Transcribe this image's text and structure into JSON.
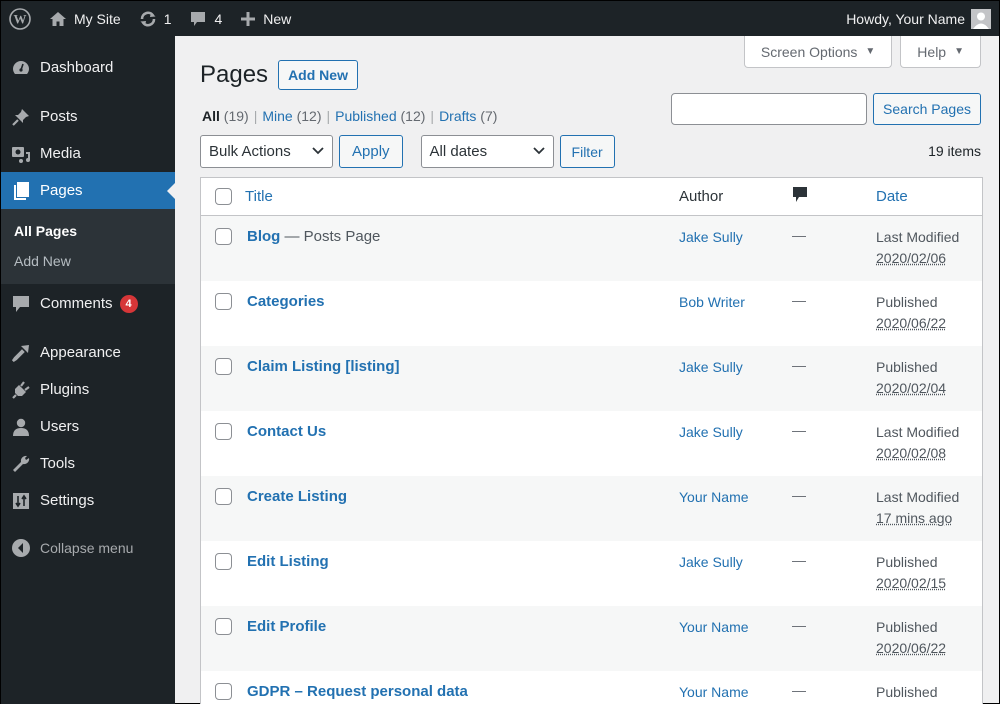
{
  "adminbar": {
    "site_name": "My Site",
    "updates_count": "1",
    "comments_count": "4",
    "new_label": "New",
    "howdy": "Howdy, Your Name"
  },
  "sidebar": {
    "items": [
      {
        "label": "Dashboard",
        "icon": "dashboard-icon"
      },
      {
        "label": "Posts",
        "icon": "pin-icon"
      },
      {
        "label": "Media",
        "icon": "media-icon"
      },
      {
        "label": "Pages",
        "icon": "pages-icon"
      },
      {
        "label": "Comments",
        "icon": "comment-icon",
        "badge": "4"
      },
      {
        "label": "Appearance",
        "icon": "brush-icon"
      },
      {
        "label": "Plugins",
        "icon": "plugin-icon"
      },
      {
        "label": "Users",
        "icon": "user-icon"
      },
      {
        "label": "Tools",
        "icon": "wrench-icon"
      },
      {
        "label": "Settings",
        "icon": "settings-icon"
      }
    ],
    "submenu": [
      "All Pages",
      "Add New"
    ],
    "collapse_label": "Collapse menu"
  },
  "screen_meta": {
    "screen_options": "Screen Options",
    "help": "Help"
  },
  "header": {
    "title": "Pages",
    "add_new": "Add New"
  },
  "views": [
    {
      "label": "All",
      "count": "(19)"
    },
    {
      "label": "Mine",
      "count": "(12)"
    },
    {
      "label": "Published",
      "count": "(12)"
    },
    {
      "label": "Drafts",
      "count": "(7)"
    }
  ],
  "search": {
    "value": "",
    "button": "Search Pages"
  },
  "tablenav": {
    "bulk_actions": "Bulk Actions",
    "apply": "Apply",
    "dates": "All dates",
    "filter": "Filter",
    "items_count": "19 items"
  },
  "table": {
    "columns": {
      "title": "Title",
      "author": "Author",
      "date": "Date"
    },
    "rows": [
      {
        "title": "Blog",
        "state": " — Posts Page",
        "author": "Jake Sully",
        "comments": "—",
        "status": "Last Modified",
        "date": "2020/02/06"
      },
      {
        "title": "Categories",
        "state": "",
        "author": "Bob Writer",
        "comments": "—",
        "status": "Published",
        "date": "2020/06/22"
      },
      {
        "title": "Claim Listing [listing]",
        "state": "",
        "author": "Jake Sully",
        "comments": "—",
        "status": "Published",
        "date": "2020/02/04"
      },
      {
        "title": "Contact Us",
        "state": "",
        "author": "Jake Sully",
        "comments": "—",
        "status": "Last Modified",
        "date": "2020/02/08"
      },
      {
        "title": "Create Listing",
        "state": "",
        "author": "Your Name",
        "comments": "—",
        "status": "Last Modified",
        "date": "17 mins ago"
      },
      {
        "title": "Edit Listing",
        "state": "",
        "author": "Jake Sully",
        "comments": "—",
        "status": "Published",
        "date": "2020/02/15"
      },
      {
        "title": "Edit Profile",
        "state": "",
        "author": "Your Name",
        "comments": "—",
        "status": "Published",
        "date": "2020/06/22"
      },
      {
        "title": "GDPR – Request personal data",
        "state": "",
        "author": "Your Name",
        "comments": "—",
        "status": "Published",
        "date": ""
      }
    ]
  },
  "colors": {
    "accent": "#2271b1",
    "adminbar_bg": "#1d2327",
    "badge": "#d63638"
  }
}
